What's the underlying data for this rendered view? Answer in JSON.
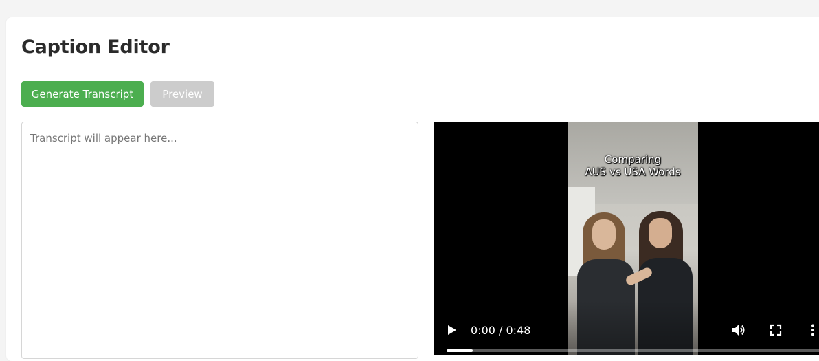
{
  "page": {
    "title": "Caption Editor"
  },
  "toolbar": {
    "generate_label": "Generate Transcript",
    "preview_label": "Preview",
    "generate_color": "#4cae4f",
    "preview_color": "#cccccc"
  },
  "transcript": {
    "value": "",
    "placeholder": "Transcript will appear here..."
  },
  "video": {
    "caption_line1": "Comparing",
    "caption_line2": "AUS vs USA Words",
    "time_display": "0:00 / 0:48",
    "buffered_fraction": 0.068,
    "icons": [
      "play-icon",
      "volume-icon",
      "fullscreen-icon",
      "more-options-icon"
    ]
  }
}
